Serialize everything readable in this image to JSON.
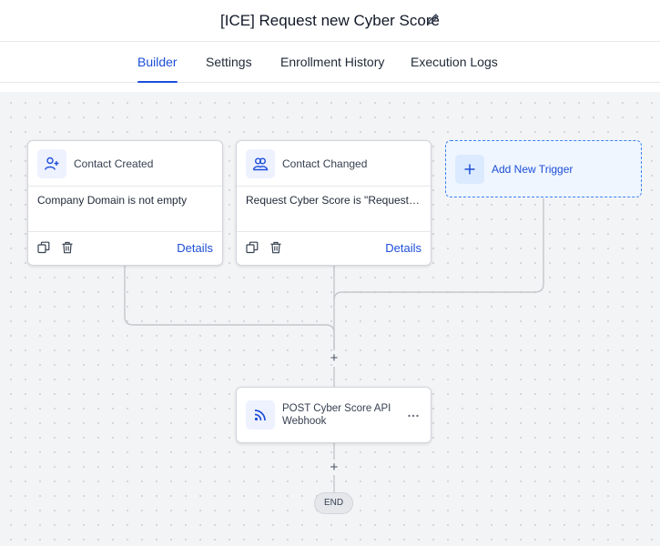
{
  "header": {
    "title": "[ICE] Request new Cyber Score",
    "edit_icon": "pencil-icon"
  },
  "tabs": [
    {
      "label": "Builder",
      "active": true
    },
    {
      "label": "Settings",
      "active": false
    },
    {
      "label": "Enrollment History",
      "active": false
    },
    {
      "label": "Execution Logs",
      "active": false
    }
  ],
  "triggers": [
    {
      "title": "Contact Created",
      "icon": "user-plus-icon",
      "condition": "Company Domain is not empty",
      "details_label": "Details",
      "duplicate_icon": "copy-icon",
      "delete_icon": "trash-icon"
    },
    {
      "title": "Contact Changed",
      "icon": "users-icon",
      "condition": "Request Cyber Score is \"Request New ...",
      "details_label": "Details",
      "duplicate_icon": "copy-icon",
      "delete_icon": "trash-icon"
    }
  ],
  "add_trigger": {
    "label": "Add New Trigger",
    "icon": "plus-icon"
  },
  "flow": {
    "plus_symbol": "+",
    "action": {
      "title": "POST Cyber Score API Webhook",
      "icon": "rss-icon",
      "menu_icon": "more-horizontal-icon"
    },
    "end_label": "END"
  },
  "colors": {
    "accent": "#1d4ed8",
    "canvas": "#f3f4f6",
    "connector": "#c4c7cc"
  }
}
